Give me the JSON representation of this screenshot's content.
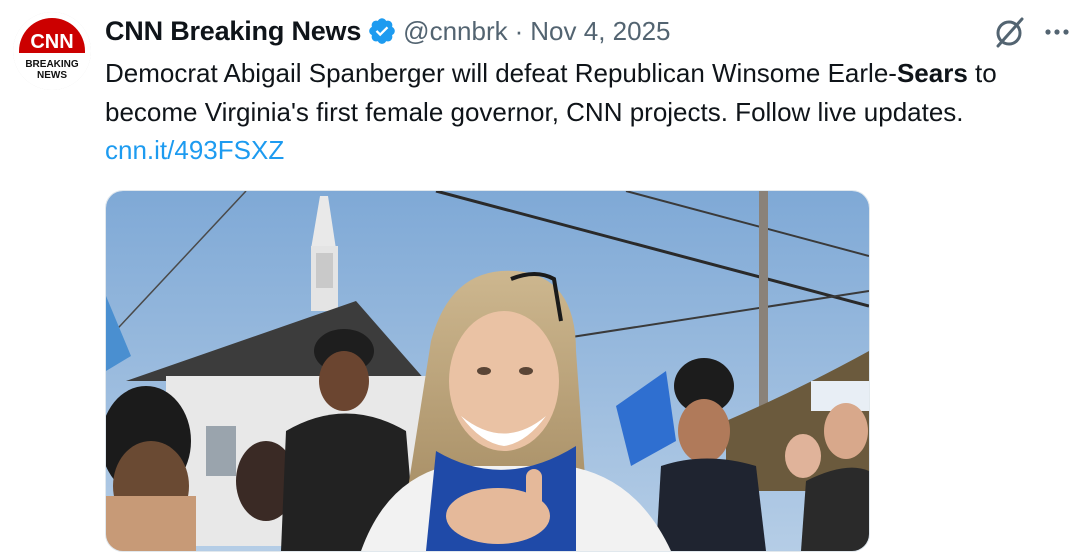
{
  "account": {
    "display_name": "CNN Breaking News",
    "handle": "@cnnbrk",
    "separator": "·",
    "date": "Nov 4, 2025",
    "avatar_text": {
      "logo": "CNN",
      "line1": "BREAKING",
      "line2": "NEWS"
    },
    "verified_icon": "verified-badge-icon"
  },
  "actions": {
    "grok_icon": "grok-icon",
    "more_icon": "more-icon"
  },
  "tweet": {
    "text_1": "Democrat Abigail Spanberger will defeat Republican Winsome Earle-",
    "text_bold": "Sears",
    "text_2": " to become Virginia's first female governor, CNN projects. Follow live updates. ",
    "link": "cnn.it/493FSXZ"
  },
  "colors": {
    "link": "#1d9bf0",
    "verified": "#1d9bf0",
    "cnn_red": "#cc0000",
    "secondary_text": "#536471"
  }
}
